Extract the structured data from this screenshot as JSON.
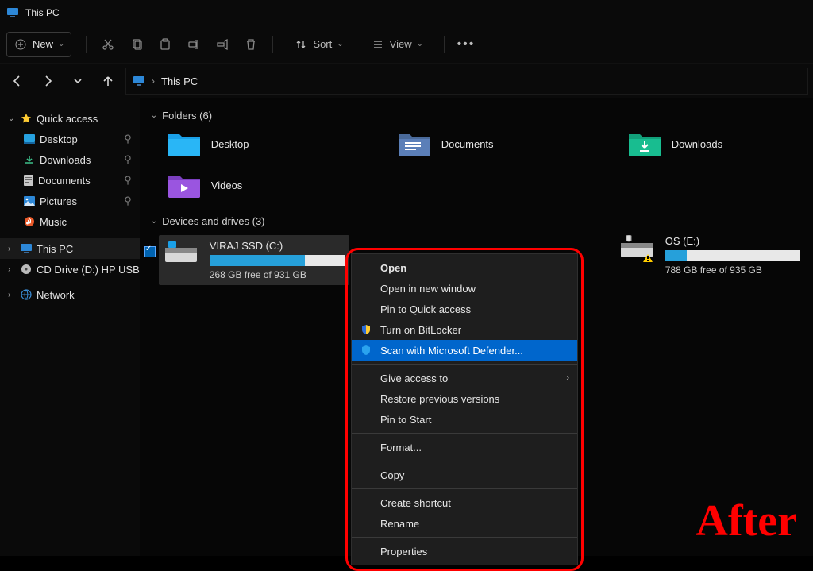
{
  "title": "This PC",
  "toolbar": {
    "new_label": "New",
    "sort_label": "Sort",
    "view_label": "View"
  },
  "breadcrumb": {
    "current": "This PC"
  },
  "sidebar": {
    "quick_access": "Quick access",
    "items": [
      {
        "label": "Desktop"
      },
      {
        "label": "Downloads"
      },
      {
        "label": "Documents"
      },
      {
        "label": "Pictures"
      },
      {
        "label": "Music"
      }
    ],
    "this_pc": "This PC",
    "cd_drive": "CD Drive (D:) HP USB",
    "network": "Network"
  },
  "sections": {
    "folders_head": "Folders (6)",
    "drives_head": "Devices and drives (3)"
  },
  "folders": [
    {
      "label": "Desktop"
    },
    {
      "label": "Documents"
    },
    {
      "label": "Downloads"
    },
    {
      "label": "Videos"
    }
  ],
  "drives": [
    {
      "name": "VIRAJ SSD (C:)",
      "free_text": "268 GB free of 931 GB",
      "used_pct": 71
    },
    {
      "name": "OS (E:)",
      "free_text": "788 GB free of 935 GB",
      "used_pct": 16
    }
  ],
  "context_menu": {
    "items": [
      {
        "label": "Open",
        "bold": true
      },
      {
        "label": "Open in new window"
      },
      {
        "label": "Pin to Quick access"
      },
      {
        "label": "Turn on BitLocker",
        "icon": "shield"
      },
      {
        "label": "Scan with Microsoft Defender...",
        "icon": "defender",
        "highlight": true
      },
      {
        "sep": true
      },
      {
        "label": "Give access to",
        "submenu": true
      },
      {
        "label": "Restore previous versions"
      },
      {
        "label": "Pin to Start"
      },
      {
        "sep": true
      },
      {
        "label": "Format..."
      },
      {
        "sep": true
      },
      {
        "label": "Copy"
      },
      {
        "sep": true
      },
      {
        "label": "Create shortcut"
      },
      {
        "label": "Rename"
      },
      {
        "sep": true
      },
      {
        "label": "Properties"
      }
    ]
  },
  "annotation": {
    "after": "After"
  }
}
